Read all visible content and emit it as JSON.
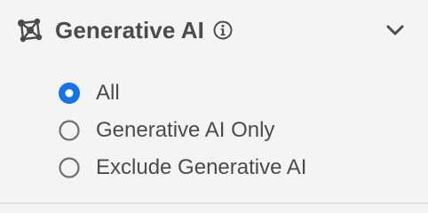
{
  "filter": {
    "title": "Generative AI",
    "header_icon": "network-nodes-icon",
    "info_icon": "info-icon",
    "toggle_icon": "chevron-down-icon",
    "accent_color": "#1473e6",
    "options": [
      {
        "label": "All",
        "selected": true
      },
      {
        "label": "Generative AI Only",
        "selected": false
      },
      {
        "label": "Exclude Generative AI",
        "selected": false
      }
    ]
  }
}
